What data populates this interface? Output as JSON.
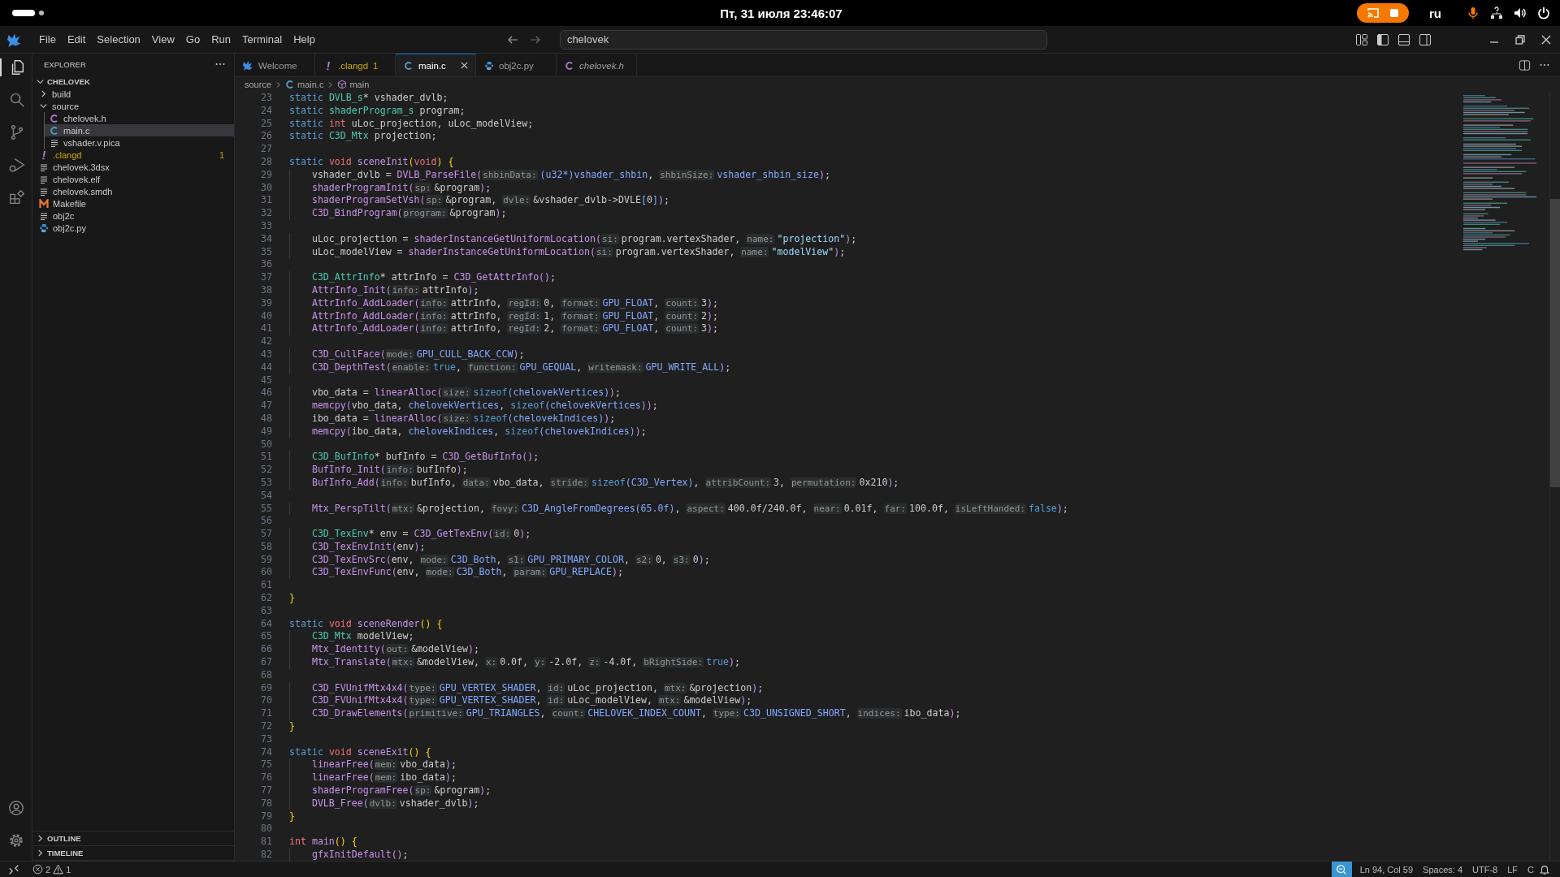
{
  "system_bar": {
    "clock": "Пт, 31 июля  23:46:07",
    "keyboard_layout": "ru",
    "recording": true
  },
  "menu": [
    "File",
    "Edit",
    "Selection",
    "View",
    "Go",
    "Run",
    "Terminal",
    "Help"
  ],
  "command_center": {
    "value": "chelovek"
  },
  "activity_bar": [
    {
      "kind": "explorer",
      "selected": true
    },
    {
      "kind": "search",
      "selected": false
    },
    {
      "kind": "source-control",
      "selected": false
    },
    {
      "kind": "run-debug",
      "selected": false
    },
    {
      "kind": "extensions",
      "selected": false
    }
  ],
  "sidebar": {
    "title": "EXPLORER",
    "root": {
      "label": "CHELOVEK",
      "expanded": true,
      "children": [
        {
          "label": "build",
          "kind": "folder",
          "expanded": false,
          "selected": false,
          "warning": false
        },
        {
          "label": "source",
          "kind": "folder",
          "expanded": true,
          "selected": false,
          "warning": false,
          "children": [
            {
              "label": "chelovek.h",
              "kind": "c-header",
              "selected": false,
              "warning": false
            },
            {
              "label": "main.c",
              "kind": "c-source",
              "selected": true,
              "warning": false
            },
            {
              "label": "vshader.v.pica",
              "kind": "text",
              "selected": false,
              "warning": false
            }
          ]
        },
        {
          "label": ".clangd",
          "kind": "config",
          "selected": false,
          "warning": true,
          "badge": "1"
        },
        {
          "label": "chelovek.3dsx",
          "kind": "text",
          "selected": false,
          "warning": false
        },
        {
          "label": "chelovek.elf",
          "kind": "text",
          "selected": false,
          "warning": false
        },
        {
          "label": "chelovek.smdh",
          "kind": "text",
          "selected": false,
          "warning": false
        },
        {
          "label": "Makefile",
          "kind": "makefile",
          "selected": false,
          "warning": false
        },
        {
          "label": "obj2c",
          "kind": "text",
          "selected": false,
          "warning": false
        },
        {
          "label": "obj2c.py",
          "kind": "python",
          "selected": false,
          "warning": false
        }
      ]
    },
    "sections": [
      {
        "label": "OUTLINE",
        "expanded": false
      },
      {
        "label": "TIMELINE",
        "expanded": false
      }
    ]
  },
  "tabs": [
    {
      "label": "Welcome",
      "kind": "welcome",
      "selected": false,
      "preview": false,
      "warning": false
    },
    {
      "label": ".clangd",
      "kind": "config",
      "selected": false,
      "preview": false,
      "warning": true,
      "badge": "1"
    },
    {
      "label": "main.c",
      "kind": "c-source",
      "selected": true,
      "preview": false,
      "warning": false
    },
    {
      "label": "obj2c.py",
      "kind": "python",
      "selected": false,
      "preview": false,
      "warning": false
    },
    {
      "label": "chelovek.h",
      "kind": "c-header",
      "selected": false,
      "preview": true,
      "warning": false
    }
  ],
  "breadcrumbs": [
    {
      "label": "source",
      "kind": "folder"
    },
    {
      "label": "main.c",
      "kind": "c-source"
    },
    {
      "label": "main",
      "kind": "function"
    }
  ],
  "editor": {
    "lines": [
      {
        "number": "23",
        "indent": false,
        "tokens": [
          {
            "kind": "kw",
            "text": "static "
          },
          {
            "kind": "type",
            "text": "DVLB_s"
          },
          {
            "kind": "plain",
            "text": "* vshader_dvlb;"
          }
        ]
      },
      {
        "number": "24",
        "indent": false,
        "tokens": [
          {
            "kind": "kw",
            "text": "static "
          },
          {
            "kind": "type",
            "text": "shaderProgram_s"
          },
          {
            "kind": "plain",
            "text": " program;"
          }
        ]
      },
      {
        "number": "25",
        "indent": false,
        "tokens": [
          {
            "kind": "kw",
            "text": "static "
          },
          {
            "kind": "kw2",
            "text": "int"
          },
          {
            "kind": "plain",
            "text": " uLoc_projection, uLoc_modelView;"
          }
        ]
      },
      {
        "number": "26",
        "indent": false,
        "tokens": [
          {
            "kind": "kw",
            "text": "static "
          },
          {
            "kind": "type",
            "text": "C3D_Mtx"
          },
          {
            "kind": "plain",
            "text": " projection;"
          }
        ]
      },
      {
        "number": "27"
      },
      {
        "number": "28",
        "indent": false,
        "tokens": [
          {
            "kind": "kw",
            "text": "static "
          },
          {
            "kind": "kw2",
            "text": "void "
          },
          {
            "kind": "fn",
            "text": "sceneInit"
          },
          {
            "kind": "brace",
            "text": "("
          },
          {
            "kind": "kw2",
            "text": "void"
          },
          {
            "kind": "brace",
            "text": ") {"
          }
        ]
      },
      {
        "number": "29",
        "indent": true,
        "tokens": [
          {
            "kind": "plain",
            "text": "vshader_dvlb = "
          },
          {
            "kind": "fn",
            "text": "DVLB_ParseFile("
          },
          {
            "kind": "hint",
            "text": "shbinData:"
          },
          {
            "kind": "const",
            "text": "(u32*)vshader_shbin"
          },
          {
            "kind": "plain",
            "text": ", "
          },
          {
            "kind": "hint",
            "text": "shbinSize:"
          },
          {
            "kind": "const",
            "text": "vshader_shbin_size"
          },
          {
            "kind": "fn",
            "text": ")"
          },
          {
            "kind": "plain",
            "text": ";"
          }
        ]
      },
      {
        "number": "30",
        "indent": true,
        "tokens": [
          {
            "kind": "fn",
            "text": "shaderProgramInit("
          },
          {
            "kind": "hint",
            "text": "sp:"
          },
          {
            "kind": "plain",
            "text": "&program"
          },
          {
            "kind": "fn",
            "text": ")"
          },
          {
            "kind": "plain",
            "text": ";"
          }
        ]
      },
      {
        "number": "31",
        "indent": true,
        "tokens": [
          {
            "kind": "fn",
            "text": "shaderProgramSetVsh("
          },
          {
            "kind": "hint",
            "text": "sp:"
          },
          {
            "kind": "plain",
            "text": "&program, "
          },
          {
            "kind": "hint",
            "text": "dvle:"
          },
          {
            "kind": "plain",
            "text": "&vshader_dvlb->DVLE"
          },
          {
            "kind": "const",
            "text": "["
          },
          {
            "kind": "plain",
            "text": "0"
          },
          {
            "kind": "const",
            "text": "]"
          },
          {
            "kind": "fn",
            "text": ")"
          },
          {
            "kind": "plain",
            "text": ";"
          }
        ]
      },
      {
        "number": "32",
        "indent": true,
        "tokens": [
          {
            "kind": "fn",
            "text": "C3D_BindProgram("
          },
          {
            "kind": "hint",
            "text": "program:"
          },
          {
            "kind": "plain",
            "text": "&program"
          },
          {
            "kind": "fn",
            "text": ")"
          },
          {
            "kind": "plain",
            "text": ";"
          }
        ]
      },
      {
        "number": "33"
      },
      {
        "number": "34",
        "indent": true,
        "tokens": [
          {
            "kind": "plain",
            "text": "uLoc_projection = "
          },
          {
            "kind": "fn",
            "text": "shaderInstanceGetUniformLocation("
          },
          {
            "kind": "hint",
            "text": "si:"
          },
          {
            "kind": "plain",
            "text": "program.vertexShader, "
          },
          {
            "kind": "hint",
            "text": "name:"
          },
          {
            "kind": "str",
            "text": "\"projection\""
          },
          {
            "kind": "fn",
            "text": ")"
          },
          {
            "kind": "plain",
            "text": ";"
          }
        ]
      },
      {
        "number": "35",
        "indent": true,
        "tokens": [
          {
            "kind": "plain",
            "text": "uLoc_modelView = "
          },
          {
            "kind": "fn",
            "text": "shaderInstanceGetUniformLocation("
          },
          {
            "kind": "hint",
            "text": "si:"
          },
          {
            "kind": "plain",
            "text": "program.vertexShader, "
          },
          {
            "kind": "hint",
            "text": "name:"
          },
          {
            "kind": "str",
            "text": "\"modelView\""
          },
          {
            "kind": "fn",
            "text": ")"
          },
          {
            "kind": "plain",
            "text": ";"
          }
        ]
      },
      {
        "number": "36"
      },
      {
        "number": "37",
        "indent": true,
        "tokens": [
          {
            "kind": "type",
            "text": "C3D_AttrInfo"
          },
          {
            "kind": "plain",
            "text": "* attrInfo = "
          },
          {
            "kind": "fn",
            "text": "C3D_GetAttrInfo()"
          },
          {
            "kind": "plain",
            "text": ";"
          }
        ]
      },
      {
        "number": "38",
        "indent": true,
        "tokens": [
          {
            "kind": "fn",
            "text": "AttrInfo_Init("
          },
          {
            "kind": "hint",
            "text": "info:"
          },
          {
            "kind": "plain",
            "text": "attrInfo"
          },
          {
            "kind": "fn",
            "text": ")"
          },
          {
            "kind": "plain",
            "text": ";"
          }
        ]
      },
      {
        "number": "39",
        "indent": true,
        "tokens": [
          {
            "kind": "fn",
            "text": "AttrInfo_AddLoader("
          },
          {
            "kind": "hint",
            "text": "info:"
          },
          {
            "kind": "plain",
            "text": "attrInfo, "
          },
          {
            "kind": "hint",
            "text": "regId:"
          },
          {
            "kind": "plain",
            "text": "0, "
          },
          {
            "kind": "hint",
            "text": "format:"
          },
          {
            "kind": "const",
            "text": "GPU_FLOAT"
          },
          {
            "kind": "plain",
            "text": ", "
          },
          {
            "kind": "hint",
            "text": "count:"
          },
          {
            "kind": "plain",
            "text": "3"
          },
          {
            "kind": "fn",
            "text": ")"
          },
          {
            "kind": "plain",
            "text": ";"
          }
        ]
      },
      {
        "number": "40",
        "indent": true,
        "tokens": [
          {
            "kind": "fn",
            "text": "AttrInfo_AddLoader("
          },
          {
            "kind": "hint",
            "text": "info:"
          },
          {
            "kind": "plain",
            "text": "attrInfo, "
          },
          {
            "kind": "hint",
            "text": "regId:"
          },
          {
            "kind": "plain",
            "text": "1, "
          },
          {
            "kind": "hint",
            "text": "format:"
          },
          {
            "kind": "const",
            "text": "GPU_FLOAT"
          },
          {
            "kind": "plain",
            "text": ", "
          },
          {
            "kind": "hint",
            "text": "count:"
          },
          {
            "kind": "plain",
            "text": "2"
          },
          {
            "kind": "fn",
            "text": ")"
          },
          {
            "kind": "plain",
            "text": ";"
          }
        ]
      },
      {
        "number": "41",
        "indent": true,
        "tokens": [
          {
            "kind": "fn",
            "text": "AttrInfo_AddLoader("
          },
          {
            "kind": "hint",
            "text": "info:"
          },
          {
            "kind": "plain",
            "text": "attrInfo, "
          },
          {
            "kind": "hint",
            "text": "regId:"
          },
          {
            "kind": "plain",
            "text": "2, "
          },
          {
            "kind": "hint",
            "text": "format:"
          },
          {
            "kind": "const",
            "text": "GPU_FLOAT"
          },
          {
            "kind": "plain",
            "text": ", "
          },
          {
            "kind": "hint",
            "text": "count:"
          },
          {
            "kind": "plain",
            "text": "3"
          },
          {
            "kind": "fn",
            "text": ")"
          },
          {
            "kind": "plain",
            "text": ";"
          }
        ]
      },
      {
        "number": "42"
      },
      {
        "number": "43",
        "indent": true,
        "tokens": [
          {
            "kind": "fn",
            "text": "C3D_CullFace("
          },
          {
            "kind": "hint",
            "text": "mode:"
          },
          {
            "kind": "const",
            "text": "GPU_CULL_BACK_CCW"
          },
          {
            "kind": "fn",
            "text": ")"
          },
          {
            "kind": "plain",
            "text": ";"
          }
        ]
      },
      {
        "number": "44",
        "indent": true,
        "tokens": [
          {
            "kind": "fn",
            "text": "C3D_DepthTest("
          },
          {
            "kind": "hint",
            "text": "enable:"
          },
          {
            "kind": "kw",
            "text": "true"
          },
          {
            "kind": "plain",
            "text": ", "
          },
          {
            "kind": "hint",
            "text": "function:"
          },
          {
            "kind": "const",
            "text": "GPU_GEQUAL"
          },
          {
            "kind": "plain",
            "text": ", "
          },
          {
            "kind": "hint",
            "text": "writemask:"
          },
          {
            "kind": "const",
            "text": "GPU_WRITE_ALL"
          },
          {
            "kind": "fn",
            "text": ")"
          },
          {
            "kind": "plain",
            "text": ";"
          }
        ]
      },
      {
        "number": "45"
      },
      {
        "number": "46",
        "indent": true,
        "tokens": [
          {
            "kind": "plain",
            "text": "vbo_data = "
          },
          {
            "kind": "fn",
            "text": "linearAlloc("
          },
          {
            "kind": "hint",
            "text": "size:"
          },
          {
            "kind": "kw",
            "text": "sizeof"
          },
          {
            "kind": "const",
            "text": "(chelovekVertices)"
          },
          {
            "kind": "fn",
            "text": ")"
          },
          {
            "kind": "plain",
            "text": ";"
          }
        ]
      },
      {
        "number": "47",
        "indent": true,
        "tokens": [
          {
            "kind": "fn",
            "text": "memcpy("
          },
          {
            "kind": "plain",
            "text": "vbo_data, "
          },
          {
            "kind": "const",
            "text": "chelovekVertices"
          },
          {
            "kind": "plain",
            "text": ", "
          },
          {
            "kind": "kw",
            "text": "sizeof"
          },
          {
            "kind": "const",
            "text": "(chelovekVertices)"
          },
          {
            "kind": "fn",
            "text": ")"
          },
          {
            "kind": "plain",
            "text": ";"
          }
        ]
      },
      {
        "number": "48",
        "indent": true,
        "tokens": [
          {
            "kind": "plain",
            "text": "ibo_data = "
          },
          {
            "kind": "fn",
            "text": "linearAlloc("
          },
          {
            "kind": "hint",
            "text": "size:"
          },
          {
            "kind": "kw",
            "text": "sizeof"
          },
          {
            "kind": "const",
            "text": "(chelovekIndices)"
          },
          {
            "kind": "fn",
            "text": ")"
          },
          {
            "kind": "plain",
            "text": ";"
          }
        ]
      },
      {
        "number": "49",
        "indent": true,
        "tokens": [
          {
            "kind": "fn",
            "text": "memcpy("
          },
          {
            "kind": "plain",
            "text": "ibo_data, "
          },
          {
            "kind": "const",
            "text": "chelovekIndices"
          },
          {
            "kind": "plain",
            "text": ", "
          },
          {
            "kind": "kw",
            "text": "sizeof"
          },
          {
            "kind": "const",
            "text": "(chelovekIndices)"
          },
          {
            "kind": "fn",
            "text": ")"
          },
          {
            "kind": "plain",
            "text": ";"
          }
        ]
      },
      {
        "number": "50"
      },
      {
        "number": "51",
        "indent": true,
        "tokens": [
          {
            "kind": "type",
            "text": "C3D_BufInfo"
          },
          {
            "kind": "plain",
            "text": "* bufInfo = "
          },
          {
            "kind": "fn",
            "text": "C3D_GetBufInfo()"
          },
          {
            "kind": "plain",
            "text": ";"
          }
        ]
      },
      {
        "number": "52",
        "indent": true,
        "tokens": [
          {
            "kind": "fn",
            "text": "BufInfo_Init("
          },
          {
            "kind": "hint",
            "text": "info:"
          },
          {
            "kind": "plain",
            "text": "bufInfo"
          },
          {
            "kind": "fn",
            "text": ")"
          },
          {
            "kind": "plain",
            "text": ";"
          }
        ]
      },
      {
        "number": "53",
        "indent": true,
        "tokens": [
          {
            "kind": "fn",
            "text": "BufInfo_Add("
          },
          {
            "kind": "hint",
            "text": "info:"
          },
          {
            "kind": "plain",
            "text": "bufInfo, "
          },
          {
            "kind": "hint",
            "text": "data:"
          },
          {
            "kind": "plain",
            "text": "vbo_data, "
          },
          {
            "kind": "hint",
            "text": "stride:"
          },
          {
            "kind": "kw",
            "text": "sizeof"
          },
          {
            "kind": "const",
            "text": "(C3D_Vertex)"
          },
          {
            "kind": "plain",
            "text": ", "
          },
          {
            "kind": "hint",
            "text": "attribCount:"
          },
          {
            "kind": "plain",
            "text": "3, "
          },
          {
            "kind": "hint",
            "text": "permutation:"
          },
          {
            "kind": "plain",
            "text": "0x210"
          },
          {
            "kind": "fn",
            "text": ")"
          },
          {
            "kind": "plain",
            "text": ";"
          }
        ]
      },
      {
        "number": "54"
      },
      {
        "number": "55",
        "indent": true,
        "tokens": [
          {
            "kind": "fn",
            "text": "Mtx_PerspTilt("
          },
          {
            "kind": "hint",
            "text": "mtx:"
          },
          {
            "kind": "plain",
            "text": "&projection, "
          },
          {
            "kind": "hint",
            "text": "fovy:"
          },
          {
            "kind": "const",
            "text": "C3D_AngleFromDegrees(65.0f)"
          },
          {
            "kind": "plain",
            "text": ", "
          },
          {
            "kind": "hint",
            "text": "aspect:"
          },
          {
            "kind": "plain",
            "text": "400.0f/240.0f, "
          },
          {
            "kind": "hint",
            "text": "near:"
          },
          {
            "kind": "plain",
            "text": "0.01f, "
          },
          {
            "kind": "hint",
            "text": "far:"
          },
          {
            "kind": "plain",
            "text": "100.0f, "
          },
          {
            "kind": "hint",
            "text": "isLeftHanded:"
          },
          {
            "kind": "kw",
            "text": "false"
          },
          {
            "kind": "fn",
            "text": ")"
          },
          {
            "kind": "plain",
            "text": ";"
          }
        ]
      },
      {
        "number": "56"
      },
      {
        "number": "57",
        "indent": true,
        "tokens": [
          {
            "kind": "type",
            "text": "C3D_TexEnv"
          },
          {
            "kind": "plain",
            "text": "* env = "
          },
          {
            "kind": "fn",
            "text": "C3D_GetTexEnv("
          },
          {
            "kind": "hint",
            "text": "id:"
          },
          {
            "kind": "plain",
            "text": "0"
          },
          {
            "kind": "fn",
            "text": ")"
          },
          {
            "kind": "plain",
            "text": ";"
          }
        ]
      },
      {
        "number": "58",
        "indent": true,
        "tokens": [
          {
            "kind": "fn",
            "text": "C3D_TexEnvInit("
          },
          {
            "kind": "plain",
            "text": "env"
          },
          {
            "kind": "fn",
            "text": ")"
          },
          {
            "kind": "plain",
            "text": ";"
          }
        ]
      },
      {
        "number": "59",
        "indent": true,
        "tokens": [
          {
            "kind": "fn",
            "text": "C3D_TexEnvSrc("
          },
          {
            "kind": "plain",
            "text": "env, "
          },
          {
            "kind": "hint",
            "text": "mode:"
          },
          {
            "kind": "const",
            "text": "C3D_Both"
          },
          {
            "kind": "plain",
            "text": ", "
          },
          {
            "kind": "hint",
            "text": "s1:"
          },
          {
            "kind": "const",
            "text": "GPU_PRIMARY_COLOR"
          },
          {
            "kind": "plain",
            "text": ", "
          },
          {
            "kind": "hint",
            "text": "s2:"
          },
          {
            "kind": "plain",
            "text": "0, "
          },
          {
            "kind": "hint",
            "text": "s3:"
          },
          {
            "kind": "plain",
            "text": "0"
          },
          {
            "kind": "fn",
            "text": ")"
          },
          {
            "kind": "plain",
            "text": ";"
          }
        ]
      },
      {
        "number": "60",
        "indent": true,
        "tokens": [
          {
            "kind": "fn",
            "text": "C3D_TexEnvFunc("
          },
          {
            "kind": "plain",
            "text": "env, "
          },
          {
            "kind": "hint",
            "text": "mode:"
          },
          {
            "kind": "const",
            "text": "C3D_Both"
          },
          {
            "kind": "plain",
            "text": ", "
          },
          {
            "kind": "hint",
            "text": "param:"
          },
          {
            "kind": "const",
            "text": "GPU_REPLACE"
          },
          {
            "kind": "fn",
            "text": ")"
          },
          {
            "kind": "plain",
            "text": ";"
          }
        ]
      },
      {
        "number": "61"
      },
      {
        "number": "62",
        "indent": false,
        "tokens": [
          {
            "kind": "brace",
            "text": "}"
          }
        ]
      },
      {
        "number": "63"
      },
      {
        "number": "64",
        "indent": false,
        "tokens": [
          {
            "kind": "kw",
            "text": "static "
          },
          {
            "kind": "kw2",
            "text": "void "
          },
          {
            "kind": "fn",
            "text": "sceneRender"
          },
          {
            "kind": "brace",
            "text": "() {"
          }
        ]
      },
      {
        "number": "65",
        "indent": true,
        "tokens": [
          {
            "kind": "type",
            "text": "C3D_Mtx"
          },
          {
            "kind": "plain",
            "text": " modelView;"
          }
        ]
      },
      {
        "number": "66",
        "indent": true,
        "tokens": [
          {
            "kind": "fn",
            "text": "Mtx_Identity("
          },
          {
            "kind": "hint",
            "text": "out:"
          },
          {
            "kind": "plain",
            "text": "&modelView"
          },
          {
            "kind": "fn",
            "text": ")"
          },
          {
            "kind": "plain",
            "text": ";"
          }
        ]
      },
      {
        "number": "67",
        "indent": true,
        "tokens": [
          {
            "kind": "fn",
            "text": "Mtx_Translate("
          },
          {
            "kind": "hint",
            "text": "mtx:"
          },
          {
            "kind": "plain",
            "text": "&modelView, "
          },
          {
            "kind": "hint",
            "text": "x:"
          },
          {
            "kind": "plain",
            "text": "0.0f, "
          },
          {
            "kind": "hint",
            "text": "y:"
          },
          {
            "kind": "plain",
            "text": "-2.0f, "
          },
          {
            "kind": "hint",
            "text": "z:"
          },
          {
            "kind": "plain",
            "text": "-4.0f, "
          },
          {
            "kind": "hint",
            "text": "bRightSide:"
          },
          {
            "kind": "kw",
            "text": "true"
          },
          {
            "kind": "fn",
            "text": ")"
          },
          {
            "kind": "plain",
            "text": ";"
          }
        ]
      },
      {
        "number": "68"
      },
      {
        "number": "69",
        "indent": true,
        "tokens": [
          {
            "kind": "fn",
            "text": "C3D_FVUnifMtx4x4("
          },
          {
            "kind": "hint",
            "text": "type:"
          },
          {
            "kind": "const",
            "text": "GPU_VERTEX_SHADER"
          },
          {
            "kind": "plain",
            "text": ", "
          },
          {
            "kind": "hint",
            "text": "id:"
          },
          {
            "kind": "plain",
            "text": "uLoc_projection, "
          },
          {
            "kind": "hint",
            "text": "mtx:"
          },
          {
            "kind": "plain",
            "text": "&projection"
          },
          {
            "kind": "fn",
            "text": ")"
          },
          {
            "kind": "plain",
            "text": ";"
          }
        ]
      },
      {
        "number": "70",
        "indent": true,
        "tokens": [
          {
            "kind": "fn",
            "text": "C3D_FVUnifMtx4x4("
          },
          {
            "kind": "hint",
            "text": "type:"
          },
          {
            "kind": "const",
            "text": "GPU_VERTEX_SHADER"
          },
          {
            "kind": "plain",
            "text": ", "
          },
          {
            "kind": "hint",
            "text": "id:"
          },
          {
            "kind": "plain",
            "text": "uLoc_modelView, "
          },
          {
            "kind": "hint",
            "text": "mtx:"
          },
          {
            "kind": "plain",
            "text": "&modelView"
          },
          {
            "kind": "fn",
            "text": ")"
          },
          {
            "kind": "plain",
            "text": ";"
          }
        ]
      },
      {
        "number": "71",
        "indent": true,
        "tokens": [
          {
            "kind": "fn",
            "text": "C3D_DrawElements("
          },
          {
            "kind": "hint",
            "text": "primitive:"
          },
          {
            "kind": "const",
            "text": "GPU_TRIANGLES"
          },
          {
            "kind": "plain",
            "text": ", "
          },
          {
            "kind": "hint",
            "text": "count:"
          },
          {
            "kind": "const",
            "text": "CHELOVEK_INDEX_COUNT"
          },
          {
            "kind": "plain",
            "text": ", "
          },
          {
            "kind": "hint",
            "text": "type:"
          },
          {
            "kind": "const",
            "text": "C3D_UNSIGNED_SHORT"
          },
          {
            "kind": "plain",
            "text": ", "
          },
          {
            "kind": "hint",
            "text": "indices:"
          },
          {
            "kind": "plain",
            "text": "ibo_data"
          },
          {
            "kind": "fn",
            "text": ")"
          },
          {
            "kind": "plain",
            "text": ";"
          }
        ]
      },
      {
        "number": "72",
        "indent": false,
        "tokens": [
          {
            "kind": "brace",
            "text": "}"
          }
        ]
      },
      {
        "number": "73"
      },
      {
        "number": "74",
        "indent": false,
        "tokens": [
          {
            "kind": "kw",
            "text": "static "
          },
          {
            "kind": "kw2",
            "text": "void "
          },
          {
            "kind": "fn",
            "text": "sceneExit"
          },
          {
            "kind": "brace",
            "text": "() {"
          }
        ]
      },
      {
        "number": "75",
        "indent": true,
        "tokens": [
          {
            "kind": "fn",
            "text": "linearFree("
          },
          {
            "kind": "hint",
            "text": "mem:"
          },
          {
            "kind": "plain",
            "text": "vbo_data"
          },
          {
            "kind": "fn",
            "text": ")"
          },
          {
            "kind": "plain",
            "text": ";"
          }
        ]
      },
      {
        "number": "76",
        "indent": true,
        "tokens": [
          {
            "kind": "fn",
            "text": "linearFree("
          },
          {
            "kind": "hint",
            "text": "mem:"
          },
          {
            "kind": "plain",
            "text": "ibo_data"
          },
          {
            "kind": "fn",
            "text": ")"
          },
          {
            "kind": "plain",
            "text": ";"
          }
        ]
      },
      {
        "number": "77",
        "indent": true,
        "tokens": [
          {
            "kind": "fn",
            "text": "shaderProgramFree("
          },
          {
            "kind": "hint",
            "text": "sp:"
          },
          {
            "kind": "plain",
            "text": "&program"
          },
          {
            "kind": "fn",
            "text": ")"
          },
          {
            "kind": "plain",
            "text": ";"
          }
        ]
      },
      {
        "number": "78",
        "indent": true,
        "tokens": [
          {
            "kind": "fn",
            "text": "DVLB_Free("
          },
          {
            "kind": "hint",
            "text": "dvlb:"
          },
          {
            "kind": "plain",
            "text": "vshader_dvlb"
          },
          {
            "kind": "fn",
            "text": ")"
          },
          {
            "kind": "plain",
            "text": ";"
          }
        ]
      },
      {
        "number": "79",
        "indent": false,
        "tokens": [
          {
            "kind": "brace",
            "text": "}"
          }
        ]
      },
      {
        "number": "80"
      },
      {
        "number": "81",
        "indent": false,
        "tokens": [
          {
            "kind": "kw2",
            "text": "int "
          },
          {
            "kind": "fn",
            "text": "main"
          },
          {
            "kind": "brace",
            "text": "() {"
          }
        ]
      },
      {
        "number": "82",
        "indent": true,
        "tokens": [
          {
            "kind": "fn",
            "text": "gfxInitDefault()"
          },
          {
            "kind": "plain",
            "text": ";"
          }
        ]
      }
    ]
  },
  "status_bar": {
    "errors": "2",
    "warnings": "1",
    "items": [
      "Ln 94, Col 59",
      "Spaces: 4",
      "UTF-8",
      "LF",
      "C"
    ]
  }
}
